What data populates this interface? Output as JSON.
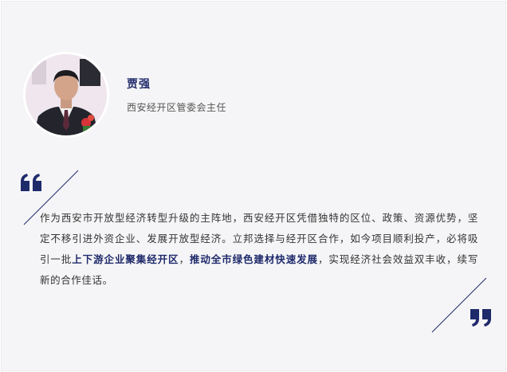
{
  "profile": {
    "name": "贾强",
    "position": "西安经开区管委会主任",
    "avatar_icon": "portrait-photo"
  },
  "quote": {
    "part1": "作为西安市开放型经济转型升级的主阵地，西安经开区凭借独特的区位、政策、资源优势，坚定不移引进外资企业、发展开放型经济。立邦选择与经开区合作，如今项目顺利投产，必将吸引一批",
    "highlight1": "上下游企业聚集经开区",
    "part2": "，",
    "highlight2": "推动全市绿色建材快速发展",
    "part3": "，实现经济社会效益双丰收，续写新的合作佳话。"
  },
  "colors": {
    "accent": "#1f2a6b",
    "background": "#f5f5f7",
    "text": "#333333"
  }
}
